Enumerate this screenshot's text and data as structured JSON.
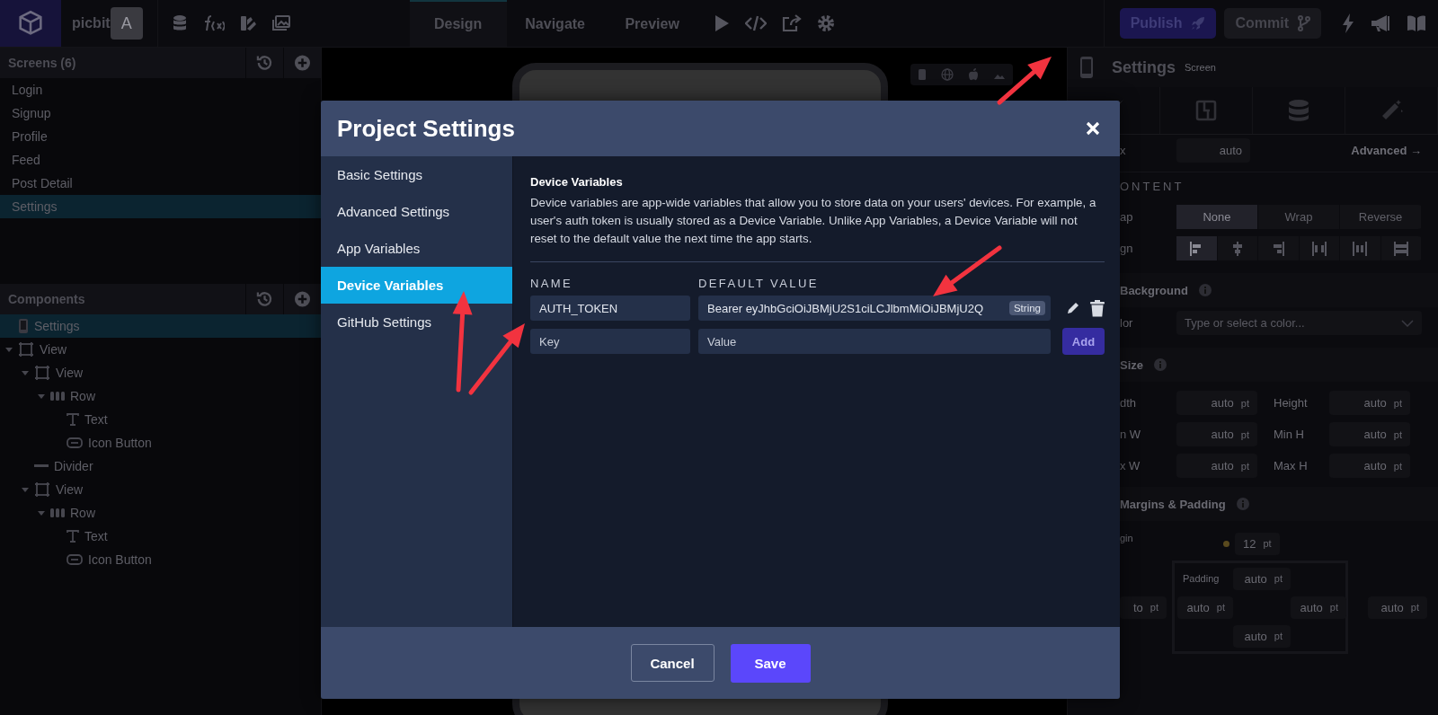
{
  "topbar": {
    "app_name": "picbit",
    "avatar": "A",
    "tabs": [
      {
        "label": "Design",
        "selected": true
      },
      {
        "label": "Navigate",
        "selected": false
      },
      {
        "label": "Preview",
        "selected": false
      }
    ],
    "publish": "Publish",
    "commit": "Commit"
  },
  "screens": {
    "title": "Screens (6)",
    "items": [
      {
        "label": "Login",
        "selected": false
      },
      {
        "label": "Signup",
        "selected": false
      },
      {
        "label": "Profile",
        "selected": false
      },
      {
        "label": "Feed",
        "selected": false
      },
      {
        "label": "Post Detail",
        "selected": false
      },
      {
        "label": "Settings",
        "selected": true
      }
    ]
  },
  "components": {
    "title": "Components",
    "tree": [
      {
        "label": "Settings",
        "kind": "screen",
        "selected": true
      },
      {
        "label": "View",
        "kind": "view",
        "selected": false,
        "expanded": true,
        "children": [
          {
            "label": "View",
            "kind": "view",
            "selected": false,
            "expanded": true,
            "children": [
              {
                "label": "Row",
                "kind": "row",
                "selected": false,
                "expanded": true,
                "children": [
                  {
                    "label": "Text",
                    "kind": "text",
                    "selected": false
                  },
                  {
                    "label": "Icon Button",
                    "kind": "icon_button",
                    "selected": false
                  }
                ]
              }
            ]
          },
          {
            "label": "Divider",
            "kind": "divider",
            "selected": false
          },
          {
            "label": "View",
            "kind": "view",
            "selected": false,
            "expanded": true,
            "children": [
              {
                "label": "Row",
                "kind": "row",
                "selected": false,
                "expanded": true,
                "children": [
                  {
                    "label": "Text",
                    "kind": "text",
                    "selected": false
                  },
                  {
                    "label": "Icon Button",
                    "kind": "icon_button",
                    "selected": false
                  }
                ]
              }
            ]
          }
        ]
      }
    ]
  },
  "inspector": {
    "title": "Settings",
    "subtitle": "Screen",
    "flex_row": {
      "label": "x",
      "value": "auto",
      "link": "Advanced →"
    },
    "content_title": "ONTENT",
    "wrap": {
      "label": "ap",
      "options": [
        {
          "label": "None",
          "selected": true
        },
        {
          "label": "Wrap",
          "selected": false
        },
        {
          "label": "Reverse",
          "selected": false
        }
      ]
    },
    "align": {
      "label": "gn",
      "options": [
        {
          "kind": "start",
          "selected": true
        },
        {
          "kind": "center",
          "selected": false
        },
        {
          "kind": "end",
          "selected": false
        },
        {
          "kind": "between",
          "selected": false
        },
        {
          "kind": "around",
          "selected": false
        },
        {
          "kind": "stretch",
          "selected": false
        }
      ]
    },
    "background": {
      "title": "Background",
      "label": "lor",
      "placeholder": "Type or select a color..."
    },
    "size": {
      "title": "Size",
      "fields": [
        {
          "label": "dth",
          "value": "auto",
          "unit": "pt"
        },
        {
          "label": "Height",
          "value": "auto",
          "unit": "pt"
        },
        {
          "label": "n W",
          "value": "auto",
          "unit": "pt"
        },
        {
          "label": "Min H",
          "value": "auto",
          "unit": "pt"
        },
        {
          "label": "x W",
          "value": "auto",
          "unit": "pt"
        },
        {
          "label": "Max H",
          "value": "auto",
          "unit": "pt"
        }
      ]
    },
    "margins": {
      "title": "Margins & Padding",
      "label": "gin",
      "margin": {
        "value": "12",
        "unit": "pt"
      },
      "padding_label": "Padding",
      "margin_left": {
        "value": "to",
        "unit": "pt"
      },
      "margin_right": {
        "value": "auto",
        "unit": "pt"
      },
      "padding_top": {
        "value": "auto",
        "unit": "pt"
      },
      "padding_left": {
        "value": "auto",
        "unit": "pt"
      },
      "padding_right": {
        "value": "auto",
        "unit": "pt"
      },
      "padding_bottom": {
        "value": "auto",
        "unit": "pt"
      }
    }
  },
  "modal": {
    "title": "Project Settings",
    "nav": [
      {
        "label": "Basic Settings",
        "selected": false
      },
      {
        "label": "Advanced Settings",
        "selected": false
      },
      {
        "label": "App Variables",
        "selected": false
      },
      {
        "label": "Device Variables",
        "selected": true
      },
      {
        "label": "GitHub Settings",
        "selected": false
      }
    ],
    "section_title": "Device Variables",
    "description": "Device variables are app-wide variables that allow you to store data on your users' devices. For example, a user's auth token is usually stored as a Device Variable. Unlike App Variables, a Device Variable will not reset to the default value the next time the app starts.",
    "columns": [
      "NAME",
      "DEFAULT VALUE"
    ],
    "variables": [
      {
        "name": "AUTH_TOKEN",
        "value": "Bearer eyJhbGciOiJBMjU2S1ciLCJlbmMiOiJBMjU2Q",
        "type": "String"
      }
    ],
    "key_placeholder": "Key",
    "value_placeholder": "Value",
    "add": "Add",
    "cancel": "Cancel",
    "save": "Save"
  }
}
